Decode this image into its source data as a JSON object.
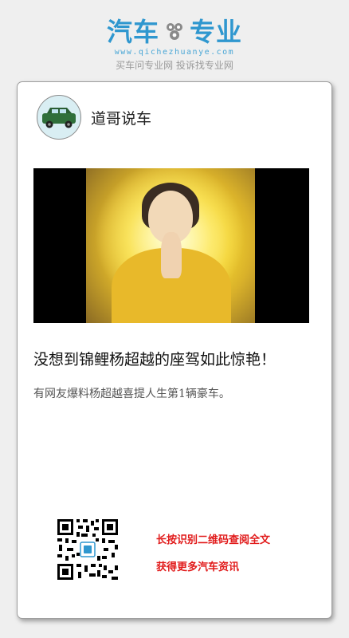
{
  "brand": {
    "logo_left": "汽车",
    "logo_right": "专业",
    "url": "www.qichezhuanye.com",
    "tagline": "买车问专业网 投诉找专业网",
    "color": "#2f97cf"
  },
  "author": {
    "name": "道哥说车",
    "avatar_icon": "car-avatar-icon"
  },
  "video": {
    "thumbnail": "video-thumbnail"
  },
  "article": {
    "title": "没想到锦鲤杨超越的座驾如此惊艳！",
    "summary": "有网友爆料杨超越喜提人生第1辆豪车。"
  },
  "cta": {
    "line1": "长按识别二维码查阅全文",
    "line2": "获得更多汽车资讯",
    "color": "#e11a1a"
  }
}
